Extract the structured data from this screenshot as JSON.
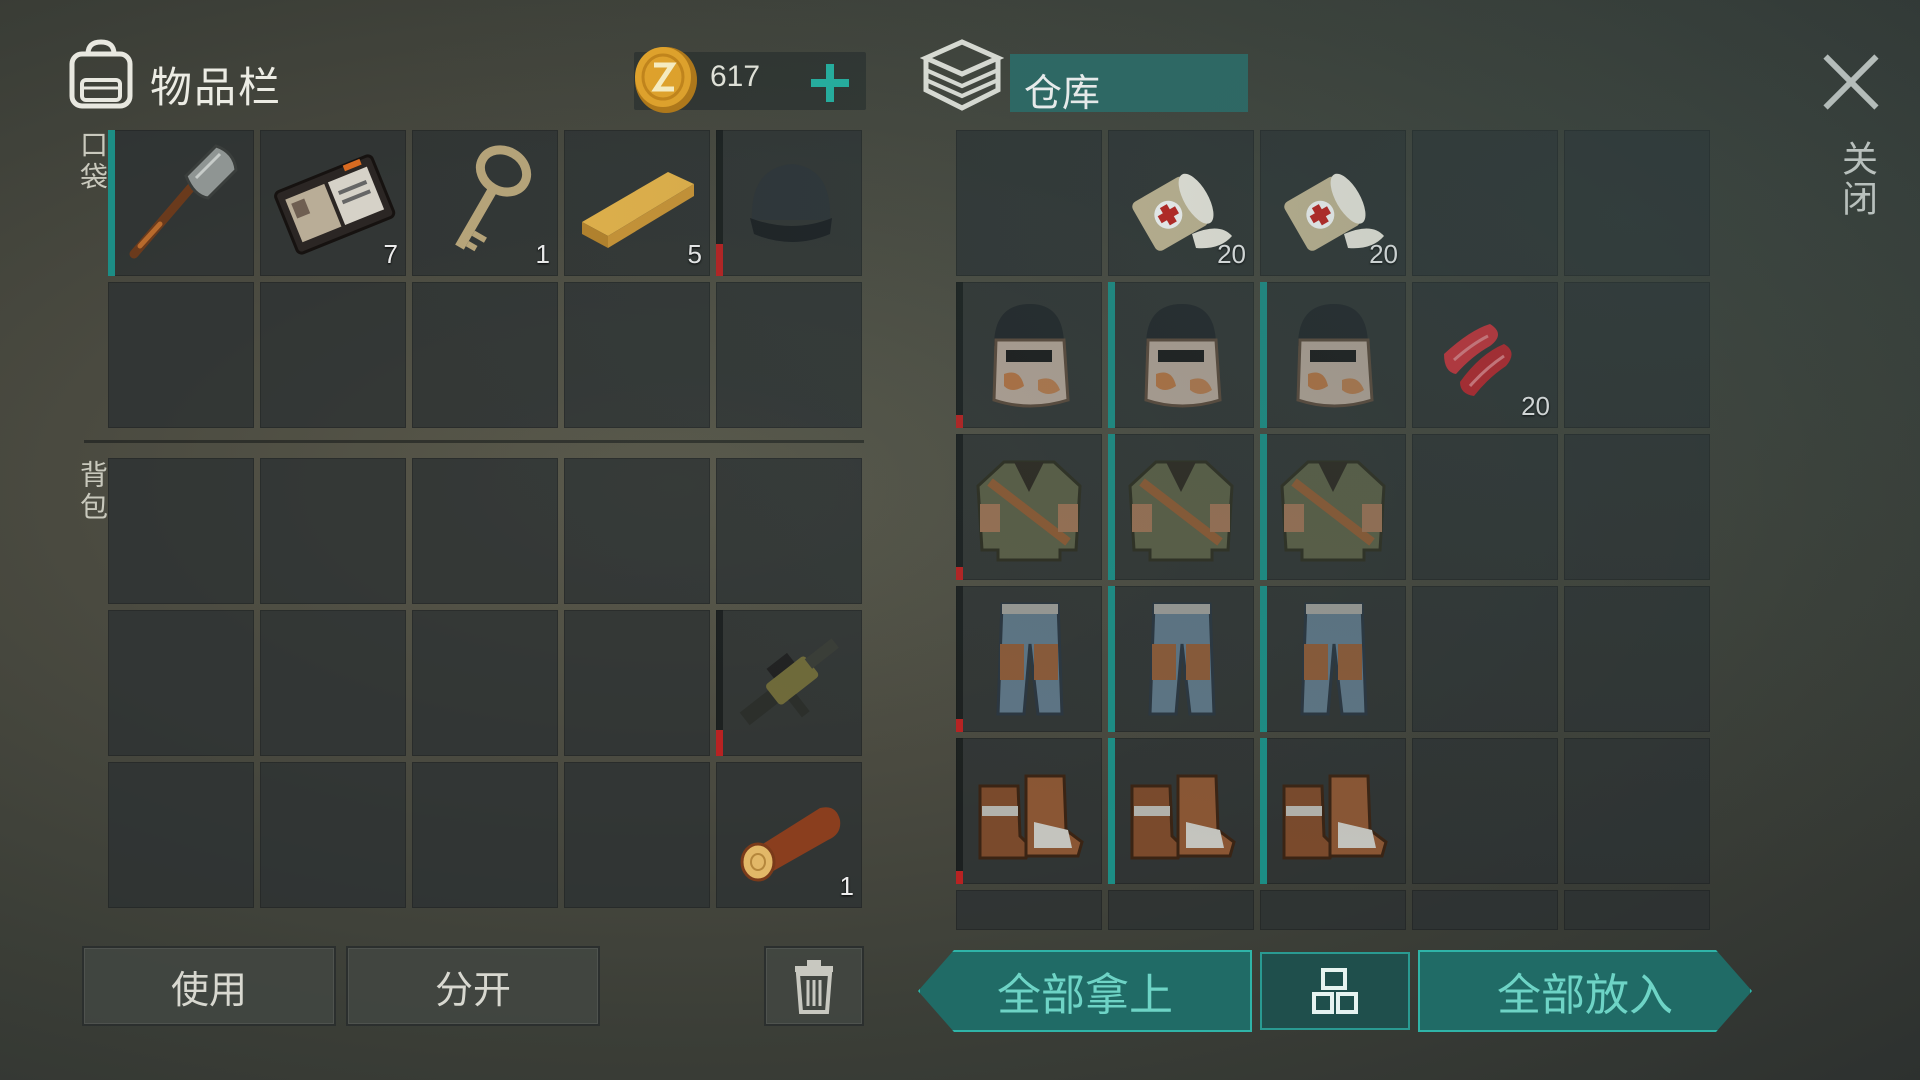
{
  "inventory": {
    "title": "物品栏",
    "coins": "617",
    "pocket_label": "口袋",
    "bag_label": "背包",
    "pocket_slots": [
      {
        "icon": "shovel-icon",
        "count": ""
      },
      {
        "icon": "wallet-icon",
        "count": "7"
      },
      {
        "icon": "key-icon",
        "count": "1"
      },
      {
        "icon": "wood-plank-icon",
        "count": "5"
      },
      {
        "icon": "beanie-hat-icon",
        "count": ""
      }
    ],
    "bag_slots": [
      {
        "icon": "grenade-launcher-icon",
        "count": ""
      },
      {
        "icon": "log-icon",
        "count": "1"
      }
    ]
  },
  "storage": {
    "title": "仓库",
    "items": [
      {
        "icon": "bandage-icon",
        "count": "20"
      },
      {
        "icon": "bandage-icon",
        "count": "20"
      },
      {
        "icon": "raw-meat-icon",
        "count": "20"
      }
    ]
  },
  "close_label": "关闭",
  "buttons": {
    "use": "使用",
    "split": "分开",
    "take_all": "全部拿上",
    "put_all": "全部放入"
  },
  "colors": {
    "accent_teal": "#24b3a3",
    "durability_red": "#b82222"
  }
}
